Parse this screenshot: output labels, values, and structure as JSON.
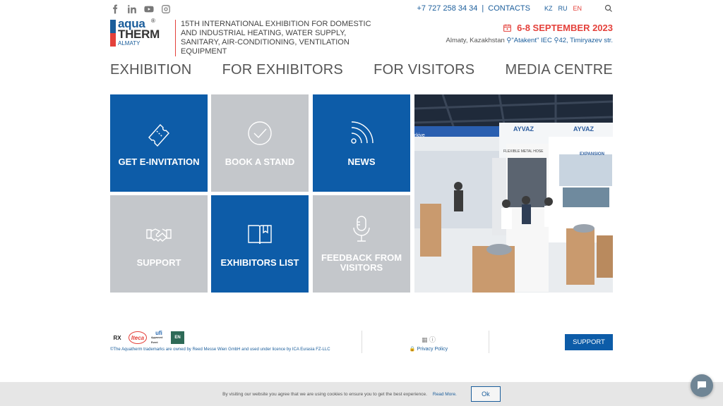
{
  "header": {
    "social_icons": [
      "facebook-icon",
      "linkedin-icon",
      "youtube-icon",
      "instagram-icon"
    ],
    "phone": "+7 727 258 34 34",
    "separator": "|",
    "contacts_label": "CONTACTS",
    "languages": [
      "KZ",
      "RU",
      "EN"
    ],
    "active_language": "EN",
    "logo": {
      "aqua": "aqua",
      "therm": "THERM",
      "city": "ALMATY",
      "reg": "®"
    },
    "tagline": "15TH INTERNATIONAL EXHIBITION FOR DOMESTIC AND INDUSTRIAL HEATING, WATER SUPPLY, SANITARY, AIR-CONDITIONING, VENTILATION EQUIPMENT",
    "dates": "6-8 SEPTEMBER 2023",
    "venue": {
      "city": "Almaty, Kazakhstan",
      "place": "\"Atakent\" IEC",
      "address": "42, Timiryazev str."
    }
  },
  "nav": [
    "EXHIBITION",
    "FOR EXHIBITORS",
    "FOR VISITORS",
    "MEDIA CENTRE"
  ],
  "tiles": {
    "invitation": "GET E-INVITATION",
    "book": "BOOK A STAND",
    "news": "NEWS",
    "support": "SUPPORT",
    "exhibitors": "EXHIBITORS LIST",
    "feedback": "FEEDBACK FROM VISITORS"
  },
  "photo_signs": {
    "brand": "AYVAZ",
    "hose": "FLEXIBLE METAL HOSE",
    "expansion": "EXPANSION",
    "country": "rkiye"
  },
  "footer": {
    "partners": [
      "RX",
      "Iteca",
      "ufi",
      "EN"
    ],
    "ufi_note": "Approved Event",
    "trademark": "©The Aquatherm trademarks are owned by Reed Messe Wien GmbH and used under licence by ICA Eurasia FZ-LLC",
    "privacy": "Privacy Policy",
    "support_button": "SUPPORT"
  },
  "cookie": {
    "text": "By visiting our website you agree that we are using cookies to ensure you to get the best experience.",
    "read_more": "Read More.",
    "ok": "Ok"
  },
  "colors": {
    "blue": "#0d5ca8",
    "red": "#e4413b",
    "grey_tile": "#c4c7cb"
  }
}
